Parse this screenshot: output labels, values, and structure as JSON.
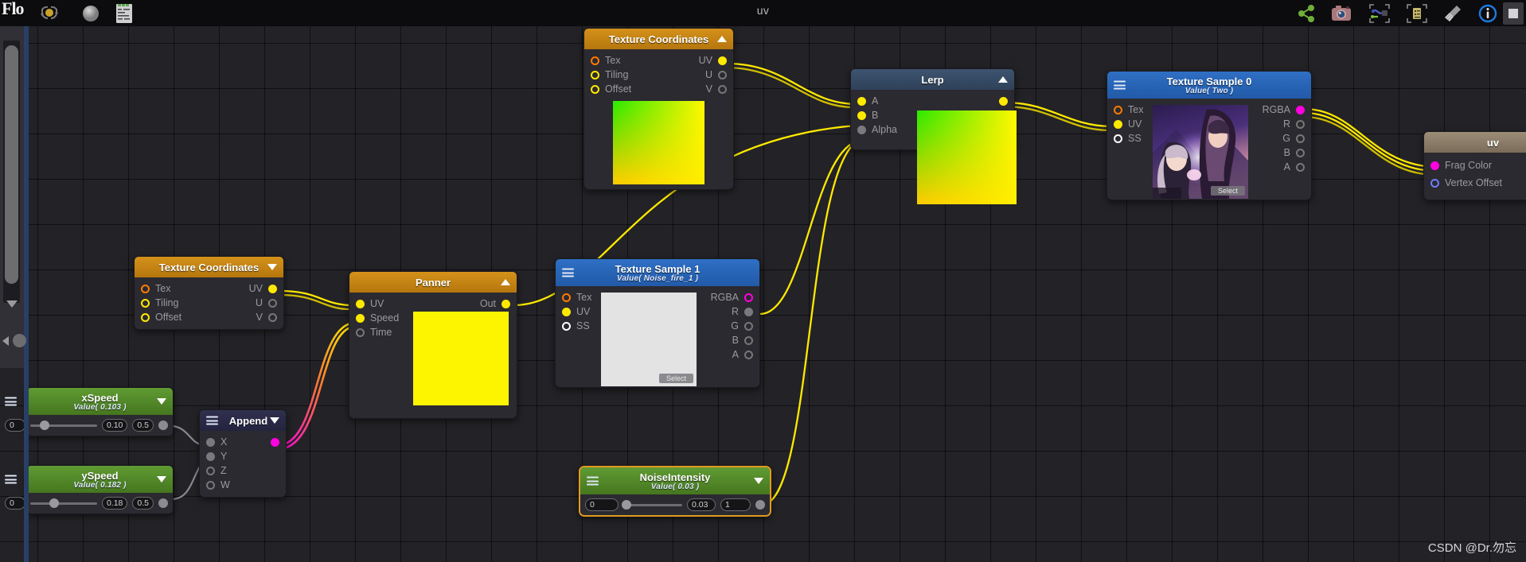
{
  "window": {
    "title": "uv",
    "logo": "Flo",
    "watermark": "CSDN @Dr.勿忘"
  },
  "toolbar": {
    "left_tools": [
      {
        "name": "refresh-preview-icon",
        "label": "Refresh Preview"
      },
      {
        "name": "sphere-preview-icon",
        "label": "Preview Mesh"
      },
      {
        "name": "code-view-icon",
        "label": "Show Shader Code"
      }
    ],
    "right_tools": [
      {
        "name": "share-nodes-icon",
        "label": "Share"
      },
      {
        "name": "camera-icon",
        "label": "Take Screenshot"
      },
      {
        "name": "focus-graph-icon",
        "label": "Focus Graph"
      },
      {
        "name": "focus-node-icon",
        "label": "Focus Node"
      },
      {
        "name": "broom-icon",
        "label": "Clean Up"
      },
      {
        "name": "info-icon",
        "label": "Information"
      },
      {
        "name": "stop-icon",
        "label": "Stop"
      }
    ]
  },
  "colors": {
    "accent_yellow": "#ffe900",
    "accent_magenta": "#ff00e0",
    "selection_orange": "#e09b1e",
    "header_orange": "#d4921a",
    "header_blue": "#2f6fc4",
    "header_green": "#5f9b33",
    "canvas_bg": "#232327"
  },
  "nodes": {
    "tex_coord_top": {
      "title": "Texture Coordinates",
      "collapse_state": "up",
      "inputs": [
        {
          "label": "Tex",
          "port": "o-orange"
        },
        {
          "label": "Tiling",
          "port": "o-yellow"
        },
        {
          "label": "Offset",
          "port": "o-yellow"
        }
      ],
      "outputs": [
        {
          "label": "UV",
          "port": "fill-y"
        },
        {
          "label": "U",
          "port": "o-grey"
        },
        {
          "label": "V",
          "port": "o-grey"
        }
      ]
    },
    "lerp": {
      "title": "Lerp",
      "collapse_state": "up",
      "inputs": [
        {
          "label": "A",
          "port": "fill-y"
        },
        {
          "label": "B",
          "port": "fill-y"
        },
        {
          "label": "Alpha",
          "port": "fill-g"
        }
      ],
      "outputs": [
        {
          "label": "",
          "port": "fill-y"
        }
      ]
    },
    "tex_sample_0": {
      "title": "Texture Sample 0",
      "subtitle": "Value( Two )",
      "inputs": [
        {
          "label": "Tex",
          "port": "o-orange"
        },
        {
          "label": "UV",
          "port": "fill-y"
        },
        {
          "label": "SS",
          "port": "o-white"
        }
      ],
      "outputs": [
        {
          "label": "RGBA",
          "port": "fill-m"
        },
        {
          "label": "R",
          "port": "o-grey"
        },
        {
          "label": "G",
          "port": "o-grey"
        },
        {
          "label": "B",
          "port": "o-grey"
        },
        {
          "label": "A",
          "port": "o-grey"
        }
      ],
      "select_label": "Select"
    },
    "output_uv": {
      "title": "uv",
      "ports": [
        {
          "label": "Frag Color",
          "port": "fill-m"
        },
        {
          "label": "Vertex Offset",
          "port": "o-blue"
        }
      ]
    },
    "tex_coord_bottom": {
      "title": "Texture Coordinates",
      "collapse_state": "down",
      "inputs": [
        {
          "label": "Tex",
          "port": "o-orange"
        },
        {
          "label": "Tiling",
          "port": "o-yellow"
        },
        {
          "label": "Offset",
          "port": "o-yellow"
        }
      ],
      "outputs": [
        {
          "label": "UV",
          "port": "fill-y"
        },
        {
          "label": "U",
          "port": "o-grey"
        },
        {
          "label": "V",
          "port": "o-grey"
        }
      ]
    },
    "panner": {
      "title": "Panner",
      "collapse_state": "up",
      "inputs": [
        {
          "label": "UV",
          "port": "fill-y"
        },
        {
          "label": "Speed",
          "port": "fill-y"
        },
        {
          "label": "Time",
          "port": "o-grey"
        }
      ],
      "outputs": [
        {
          "label": "Out",
          "port": "fill-y"
        }
      ]
    },
    "tex_sample_1": {
      "title": "Texture Sample 1",
      "subtitle": "Value( Noise_fire_1 )",
      "inputs": [
        {
          "label": "Tex",
          "port": "o-orange"
        },
        {
          "label": "UV",
          "port": "fill-y"
        },
        {
          "label": "SS",
          "port": "o-white"
        }
      ],
      "outputs": [
        {
          "label": "RGBA",
          "port": "o-magenta"
        },
        {
          "label": "R",
          "port": "fill-g"
        },
        {
          "label": "G",
          "port": "o-grey"
        },
        {
          "label": "B",
          "port": "o-grey"
        },
        {
          "label": "A",
          "port": "o-grey"
        }
      ],
      "select_label": "Select"
    },
    "xspeed": {
      "title": "xSpeed",
      "subtitle": "Value( 0.103 )",
      "collapse_state": "down",
      "slider": {
        "min": "0",
        "value": "0.10",
        "max": "0.5",
        "fraction": 0.21
      }
    },
    "yspeed": {
      "title": "ySpeed",
      "subtitle": "Value( 0.182 )",
      "collapse_state": "down",
      "slider": {
        "min": "0",
        "value": "0.18",
        "max": "0.5",
        "fraction": 0.36
      }
    },
    "append": {
      "title": "Append",
      "collapse_state": "down",
      "inputs": [
        {
          "label": "X",
          "port": "fill-g"
        },
        {
          "label": "Y",
          "port": "fill-g"
        },
        {
          "label": "Z",
          "port": "o-grey"
        },
        {
          "label": "W",
          "port": "o-grey"
        }
      ],
      "outputs": [
        {
          "label": "",
          "port": "fill-m"
        }
      ]
    },
    "noise_intensity": {
      "title": "NoiseIntensity",
      "subtitle": "Value( 0.03 )",
      "collapse_state": "down",
      "selected": true,
      "slider": {
        "min": "0",
        "value": "0.03",
        "max": "1",
        "fraction": 0.06
      }
    }
  }
}
